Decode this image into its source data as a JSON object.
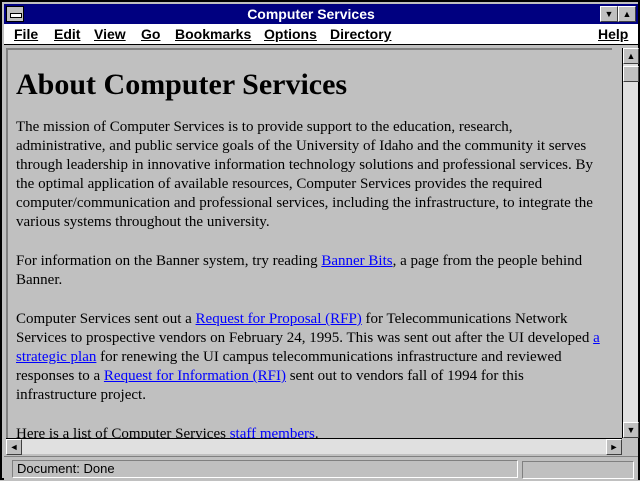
{
  "window": {
    "title": "Computer Services"
  },
  "menubar": {
    "file": "File",
    "edit": "Edit",
    "view": "View",
    "go": "Go",
    "bookmarks": "Bookmarks",
    "options": "Options",
    "directory": "Directory",
    "help": "Help"
  },
  "page": {
    "heading": "About Computer Services",
    "p1": "The mission of Computer Services is to provide support to the education, research, administrative, and public service goals of the University of Idaho and the community it serves through leadership in innovative information technology solutions and professional services. By the optimal application of available resources, Computer Services provides the required computer/communication and professional services, including the infrastructure, to integrate the various systems throughout the university.",
    "p2_a": "For information on the Banner system, try reading ",
    "p2_link": "Banner Bits",
    "p2_b": ", a page from the people behind Banner.",
    "p3_a": "Computer Services sent out a ",
    "p3_link1": "Request for Proposal (RFP)",
    "p3_b": " for Telecommunications Network Services to prospective vendors on February 24, 1995. This was sent out after the UI developed ",
    "p3_link2": "a strategic plan",
    "p3_c": " for renewing the UI campus telecommunications infrastructure and reviewed responses to a ",
    "p3_link3": "Request for Information (RFI)",
    "p3_d": " sent out to vendors fall of 1994 for this infrastructure project.",
    "p4_a": "Here is a list of Computer Services ",
    "p4_link": "staff members",
    "p4_b": "."
  },
  "status": {
    "text": "Document: Done"
  }
}
